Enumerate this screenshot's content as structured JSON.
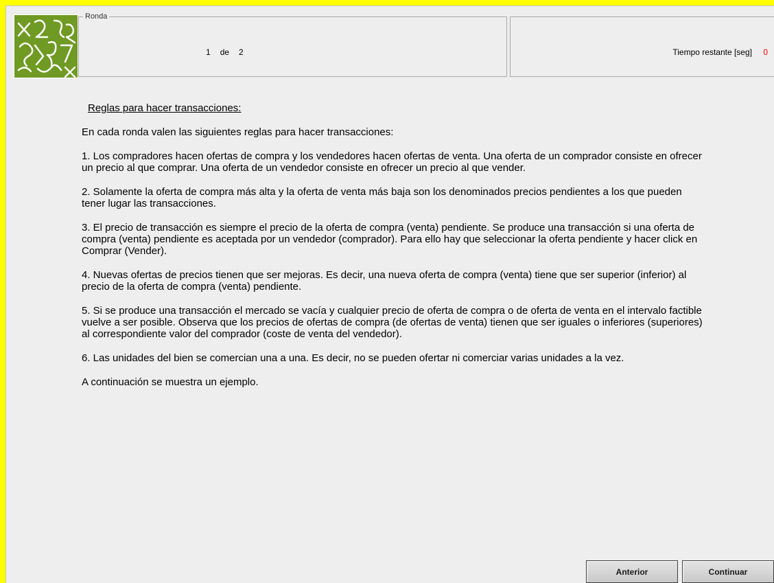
{
  "header": {
    "round_legend": "Ronda",
    "round_current": "1",
    "round_separator": "de",
    "round_total": "2",
    "time_label": "Tiempo restante [seg]",
    "time_value": "0",
    "logo_icon": "green-squiggle-logo-icon"
  },
  "rules": {
    "title": "Reglas para hacer transacciones:",
    "intro": "En cada ronda valen las siguientes reglas para hacer transacciones:",
    "items": [
      "1.  Los compradores hacen ofertas de compra y los vendedores hacen ofertas de venta. Una oferta de un comprador consiste en ofrecer un precio al que comprar. Una oferta de un  vendedor consiste en ofrecer un precio al que vender.",
      "2.  Solamente la oferta de compra más alta y la oferta de venta más baja son los denominados precios pendientes a los que pueden tener lugar las transacciones.",
      "3.  El precio de transacción es siempre el precio de la oferta de compra (venta) pendiente. Se produce una transacción si una oferta de compra (venta) pendiente es aceptada por un vendedor (comprador). Para ello hay que seleccionar la oferta pendiente y hacer click en Comprar (Vender).",
      "4.  Nuevas ofertas de precios tienen que ser mejoras. Es decir, una nueva oferta de compra (venta) tiene que ser superior (inferior) al precio de la oferta de compra (venta) pendiente.",
      "5.  Si se produce una transacción el mercado se vacía y cualquier precio de oferta de compra o de oferta de venta en el intervalo factible vuelve a ser posible. Observa que los precios de ofertas de compra (de ofertas de venta) tienen que ser iguales o inferiores (superiores) al correspondiente valor del comprador (coste de venta del vendedor).",
      "6.  Las unidades del bien se comercian una a una. Es decir, no se pueden ofertar ni comerciar varias unidades a la vez."
    ],
    "footer": "A continuación se muestra un ejemplo."
  },
  "buttons": {
    "previous": "Anterior",
    "continue": "Continuar"
  },
  "colors": {
    "outer_border": "#ffff00",
    "logo_green": "#6f9a23",
    "time_value": "#ff0000"
  }
}
